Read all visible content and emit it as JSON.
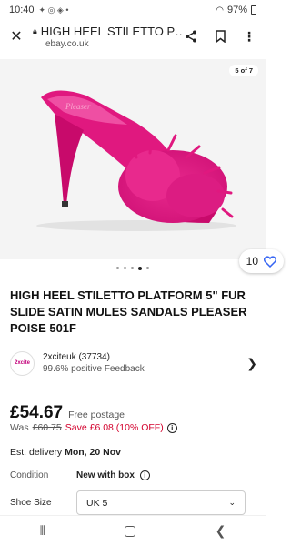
{
  "status_bar": {
    "time": "10:40",
    "battery": "97%"
  },
  "toolbar": {
    "page_title": "HIGH HEEL STILETTO P…",
    "host": "ebay.co.uk"
  },
  "gallery": {
    "counter": "5 of 7",
    "watch_count": "10",
    "dot_count": 5,
    "active_dot": 4
  },
  "listing": {
    "title": "HIGH HEEL STILETTO PLATFORM 5\" FUR SLIDE SATIN MULES SANDALS PLEASER POISE 501F"
  },
  "seller": {
    "logo_text": "2xcite",
    "name": "2xciteuk (37734)",
    "feedback": "99.6% positive Feedback"
  },
  "price": {
    "current": "£54.67",
    "postage": "Free postage",
    "was_label": "Was",
    "was_price": "£60.75",
    "save": "Save £6.08 (10% OFF)"
  },
  "delivery": {
    "label": "Est. delivery",
    "date": "Mon, 20 Nov"
  },
  "condition": {
    "label": "Condition",
    "value": "New with box"
  },
  "shoe_size": {
    "label": "Shoe Size",
    "value": "UK 5"
  },
  "colors": {
    "accent_blue": "#3665f3",
    "save_red": "#d3002c",
    "product_pink": "#e0187f"
  }
}
